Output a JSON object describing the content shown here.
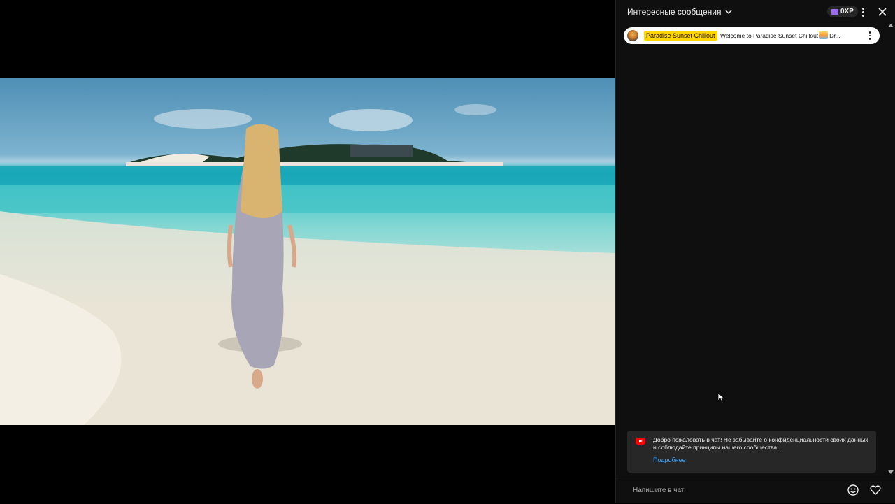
{
  "chat": {
    "header_title": "Интересные сообщения",
    "xp_badge": "0XP",
    "pinned": {
      "author": "Paradise Sunset Chillout",
      "message": "Welcome to Paradise Sunset Chillout",
      "message_tail": "Dr..."
    },
    "welcome": {
      "text": "Добро пожаловать в чат! Не забывайте о конфиденциальности своих данных и соблюдайте принципы нашего сообщества.",
      "link": "Подробнее"
    },
    "input": {
      "placeholder": "Напишите в чат"
    }
  },
  "colors": {
    "chat_bg": "#0f0f0f",
    "author_highlight": "#ffd600",
    "link": "#3ea6ff",
    "yt_red": "#ff0000",
    "xp_purple": "#9b6cf0"
  },
  "icons": [
    "chevron-down-icon",
    "xp-icon",
    "more-vert-icon",
    "close-icon",
    "youtube-icon",
    "emoji-icon",
    "heart-icon",
    "mouse-cursor-icon"
  ]
}
